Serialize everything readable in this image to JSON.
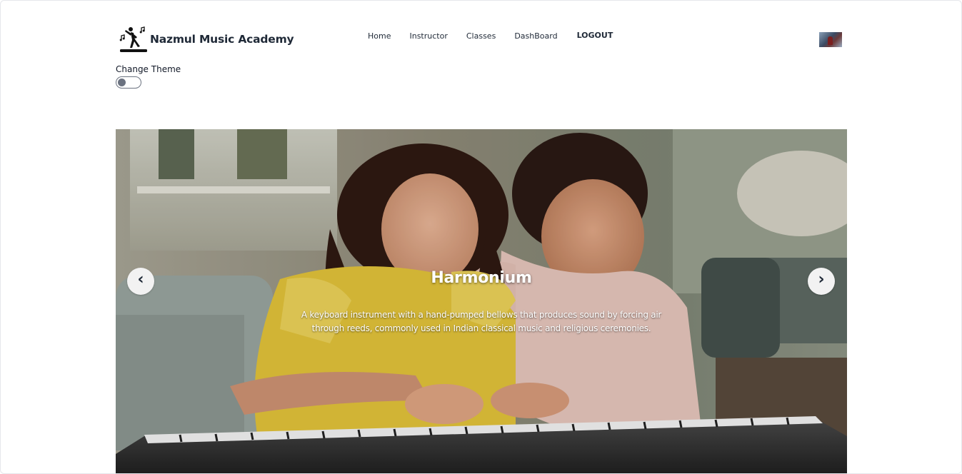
{
  "brand": {
    "name": "Nazmul Music Academy",
    "logo_icon": "dancer-music-notes-icon"
  },
  "nav": {
    "items": [
      {
        "label": "Home"
      },
      {
        "label": "Instructor"
      },
      {
        "label": "Classes"
      },
      {
        "label": "DashBoard"
      },
      {
        "label": "LOGOUT"
      }
    ]
  },
  "user": {
    "avatar_icon": "user-avatar"
  },
  "theme": {
    "label": "Change Theme",
    "enabled": false
  },
  "carousel": {
    "slide": {
      "title": "Harmonium",
      "description": "A keyboard instrument with a hand-pumped bellows that produces sound by forcing air through reeds, commonly used in Indian classical music and religious ceremonies."
    },
    "prev_glyph": "‹",
    "next_glyph": "›"
  },
  "colors": {
    "text": "#1f2937",
    "slide_text": "#ffffff",
    "arrow_bg": "#f2f2f2"
  }
}
